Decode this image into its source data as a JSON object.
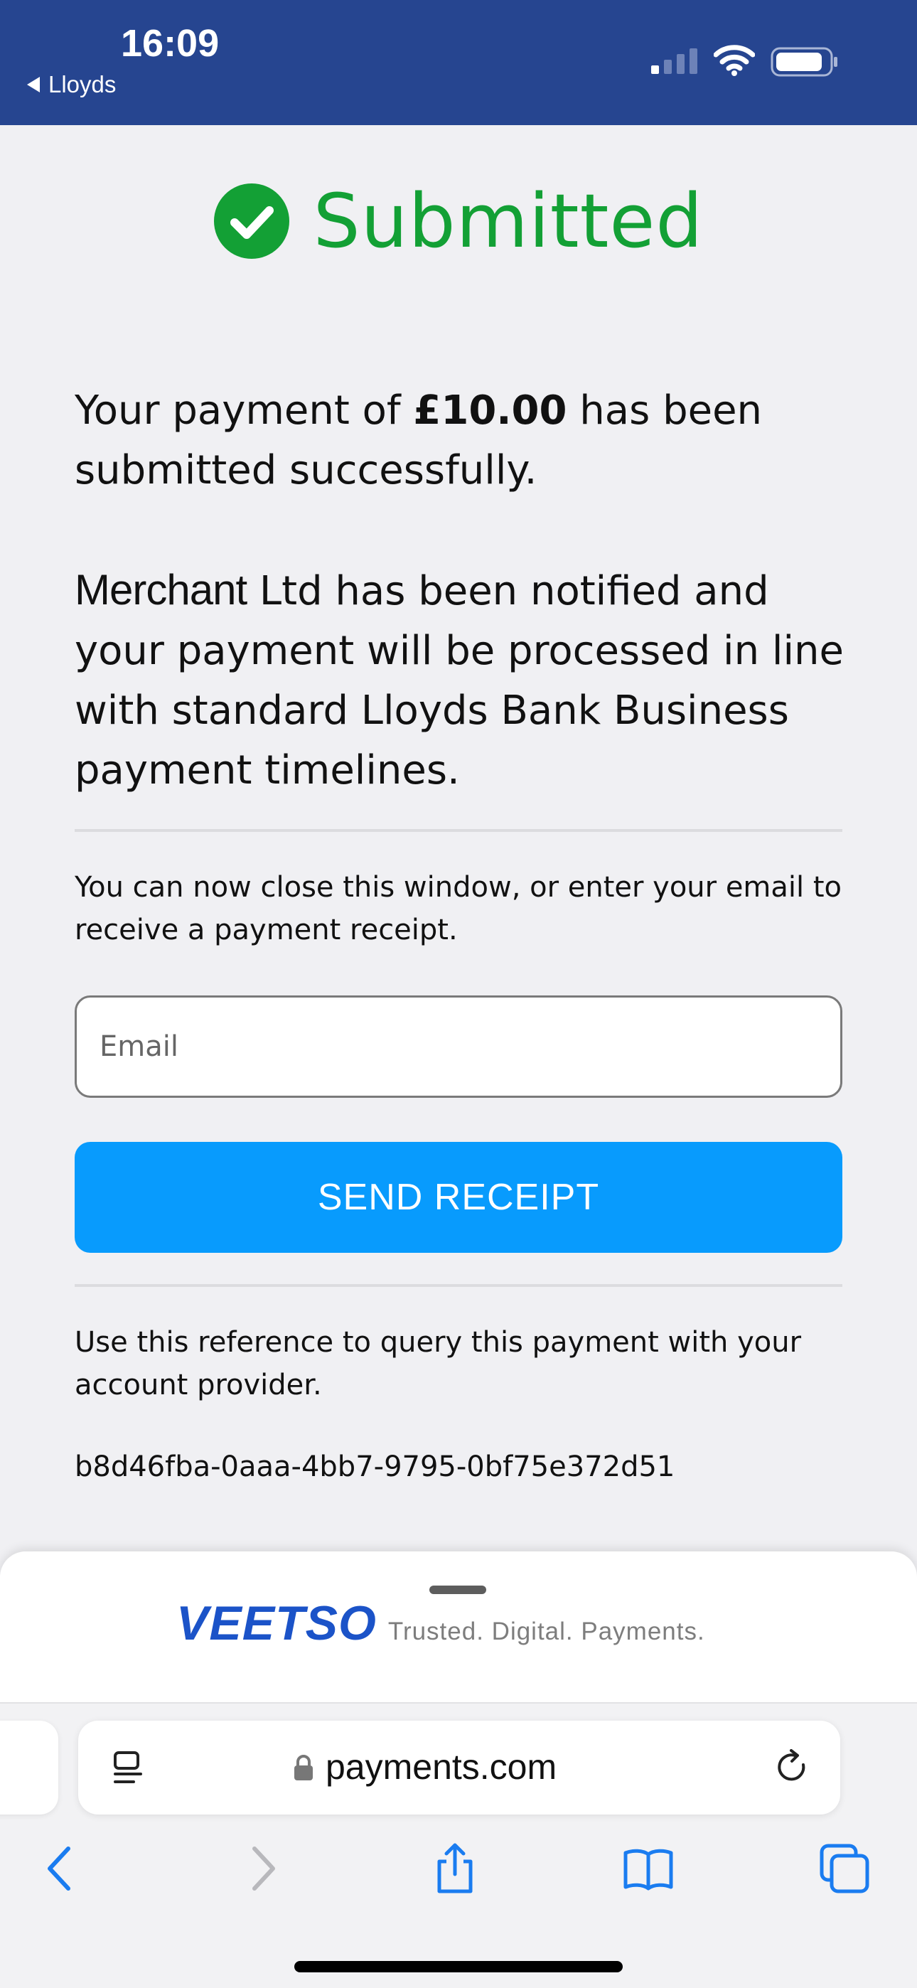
{
  "status_bar": {
    "time": "16:09",
    "back_app": "Lloyds",
    "icons": [
      "signal-icon",
      "wifi-icon",
      "battery-icon"
    ]
  },
  "confirmation": {
    "title": "Submitted",
    "title_color": "#13a035",
    "para1": {
      "before": "Your payment of ",
      "amount": "£10.00",
      "after": " has been submitted successfully."
    },
    "para2": {
      "merchant": "Merchant",
      "rest": " Ltd has been notified and your payment will be processed in line with standard Lloyds Bank Business payment timelines."
    },
    "close_note": "You can now close this window, or enter your email to receive a payment receipt.",
    "email_placeholder": "Email",
    "send_button": "SEND RECEIPT",
    "button_color": "#089bfd",
    "reference_note": "Use this reference to query this payment with your account provider.",
    "reference": "b8d46fba-0aaa-4bb7-9795-0bf75e372d51"
  },
  "footer": {
    "brand": "VEETSO",
    "tagline": "Trusted. Digital. Payments.",
    "brand_color": "#1b53c8"
  },
  "browser": {
    "url": "payments.com",
    "toolbar_icons": [
      "back-icon",
      "forward-icon",
      "share-icon",
      "bookmarks-icon",
      "tabs-icon"
    ]
  }
}
